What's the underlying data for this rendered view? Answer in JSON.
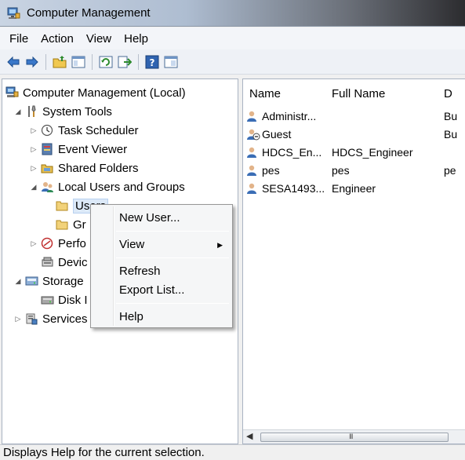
{
  "window": {
    "title": "Computer Management"
  },
  "menu": [
    "File",
    "Action",
    "View",
    "Help"
  ],
  "toolbar": {
    "buttons": [
      "back-icon",
      "forward-icon",
      "up-folder-icon",
      "show-hide-tree-icon",
      "refresh-icon",
      "export-list-icon",
      "help-icon",
      "properties-icon"
    ]
  },
  "tree": {
    "root": "Computer Management (Local)",
    "system_tools": "System Tools",
    "task_scheduler": "Task Scheduler",
    "event_viewer": "Event Viewer",
    "shared_folders": "Shared Folders",
    "local_users_groups": "Local Users and Groups",
    "users": "Users",
    "groups": "Gr",
    "performance": "Perfo",
    "device_manager": "Devic",
    "storage": "Storage",
    "disk_management": "Disk I",
    "services": "Services"
  },
  "list": {
    "columns": [
      "Name",
      "Full Name",
      "D"
    ],
    "rows": [
      {
        "name": "Administr...",
        "full_name": "",
        "desc": "Bu"
      },
      {
        "name": "Guest",
        "full_name": "",
        "desc": "Bu"
      },
      {
        "name": "HDCS_En...",
        "full_name": "HDCS_Engineer",
        "desc": ""
      },
      {
        "name": "pes",
        "full_name": "pes",
        "desc": "pe"
      },
      {
        "name": "SESA1493...",
        "full_name": "Engineer",
        "desc": ""
      }
    ],
    "scroll_grip": "III"
  },
  "context_menu": {
    "new_user": "New User...",
    "view": "View",
    "refresh": "Refresh",
    "export_list": "Export List...",
    "help": "Help"
  },
  "status": {
    "text": "Displays Help for the current selection."
  }
}
